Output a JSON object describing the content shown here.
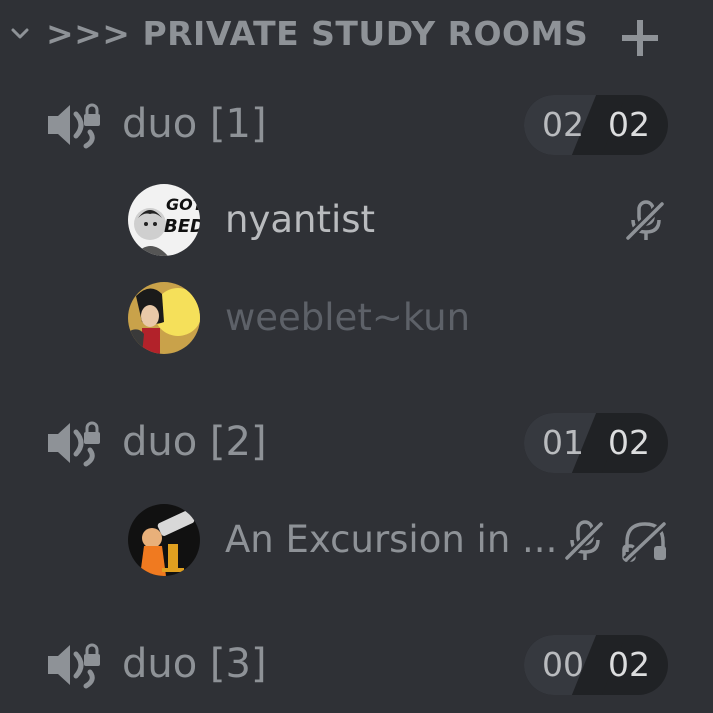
{
  "category": {
    "label": ">>> PRIVATE STUDY ROOMS",
    "collapse_icon": "chevron-down-icon",
    "add_icon": "plus-icon"
  },
  "channels": [
    {
      "name": "duo [1]",
      "icon": "locked-voice-icon",
      "limit": {
        "current": "02",
        "max": "02"
      },
      "users": [
        {
          "name": "nyantist",
          "avatar": "avatar-got-bed",
          "muted": true,
          "deafened": false,
          "dim": false
        },
        {
          "name": "weeblet~kun",
          "avatar": "avatar-anime-character",
          "muted": false,
          "deafened": false,
          "dim": true
        }
      ]
    },
    {
      "name": "duo [2]",
      "icon": "locked-voice-icon",
      "limit": {
        "current": "01",
        "max": "02"
      },
      "users": [
        {
          "name": "An Excursion in ...",
          "avatar": "avatar-telescope",
          "muted": true,
          "deafened": true,
          "dim": false
        }
      ]
    },
    {
      "name": "duo [3]",
      "icon": "locked-voice-icon",
      "limit": {
        "current": "00",
        "max": "02"
      },
      "users": []
    }
  ],
  "colors": {
    "background": "#2f3136",
    "text_muted": "#8e9297",
    "text_normal": "#b9bbbe",
    "text_dim": "#5d6168",
    "pill_dark": "#202225",
    "pill_light": "#36393f"
  }
}
